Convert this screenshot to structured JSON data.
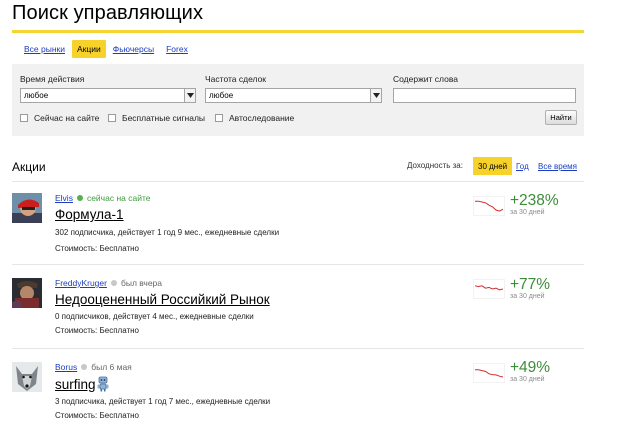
{
  "page": {
    "title": "Поиск управляющих"
  },
  "tabs": [
    {
      "label": "Все рынки",
      "active": false
    },
    {
      "label": "Акции",
      "active": true
    },
    {
      "label": "Фьючерсы",
      "active": false
    },
    {
      "label": "Forex",
      "active": false
    }
  ],
  "filters": {
    "time_label": "Время действия",
    "time_value": "любое",
    "freq_label": "Частота сделок",
    "freq_value": "любое",
    "contains_label": "Содержит слова",
    "contains_value": "",
    "checks": [
      {
        "label": "Сейчас на сайте",
        "checked": false
      },
      {
        "label": "Бесплатные сигналы",
        "checked": false
      },
      {
        "label": "Автоследование",
        "checked": false
      }
    ],
    "find_label": "Найти"
  },
  "section": {
    "title": "Акции",
    "period_label": "Доходность за:",
    "periods": [
      {
        "label": "30 дней",
        "active": true
      },
      {
        "label": "Год",
        "active": false
      },
      {
        "label": "Все время",
        "active": false
      }
    ]
  },
  "colors": {
    "accent": "#f7d22a",
    "link": "#1a3dc1",
    "positive": "#3d8c3a",
    "online": "#3e9b3e",
    "spark": "#d22e2e"
  },
  "traders": [
    {
      "user": "Elvis",
      "status": "сейчас на сайте",
      "online": true,
      "strategy": "Формула-1",
      "meta": "302 подписчика, действует 1 год 9 мес., ежедневные сделки",
      "cost": "Стоимость: Бесплатно",
      "yield": "+238%",
      "yield_period": "за 30 дней",
      "robot": false,
      "spark": [
        0.2,
        0.2,
        0.25,
        0.3,
        0.45,
        0.55,
        0.75,
        0.82,
        0.7
      ]
    },
    {
      "user": "FreddyKruger",
      "status": "был вчера",
      "online": false,
      "strategy": "Недооцененный Российкий Рынок",
      "meta": "0 подписчиков, действует 4 мес., ежедневные сделки",
      "cost": "Стоимость: Бесплатно",
      "yield": "+77%",
      "yield_period": "за 30 дней",
      "robot": false,
      "spark": [
        0.3,
        0.35,
        0.3,
        0.45,
        0.4,
        0.5,
        0.45,
        0.55,
        0.5
      ]
    },
    {
      "user": "Borus",
      "status": "был 6 мая",
      "online": false,
      "strategy": "surfing",
      "meta": "3 подписчика, действует 1 год 7 мес., ежедневные сделки",
      "cost": "Стоимость: Бесплатно",
      "yield": "+49%",
      "yield_period": "за 30 дней",
      "robot": true,
      "spark": [
        0.3,
        0.3,
        0.35,
        0.4,
        0.55,
        0.6,
        0.62,
        0.7,
        0.75
      ]
    }
  ]
}
